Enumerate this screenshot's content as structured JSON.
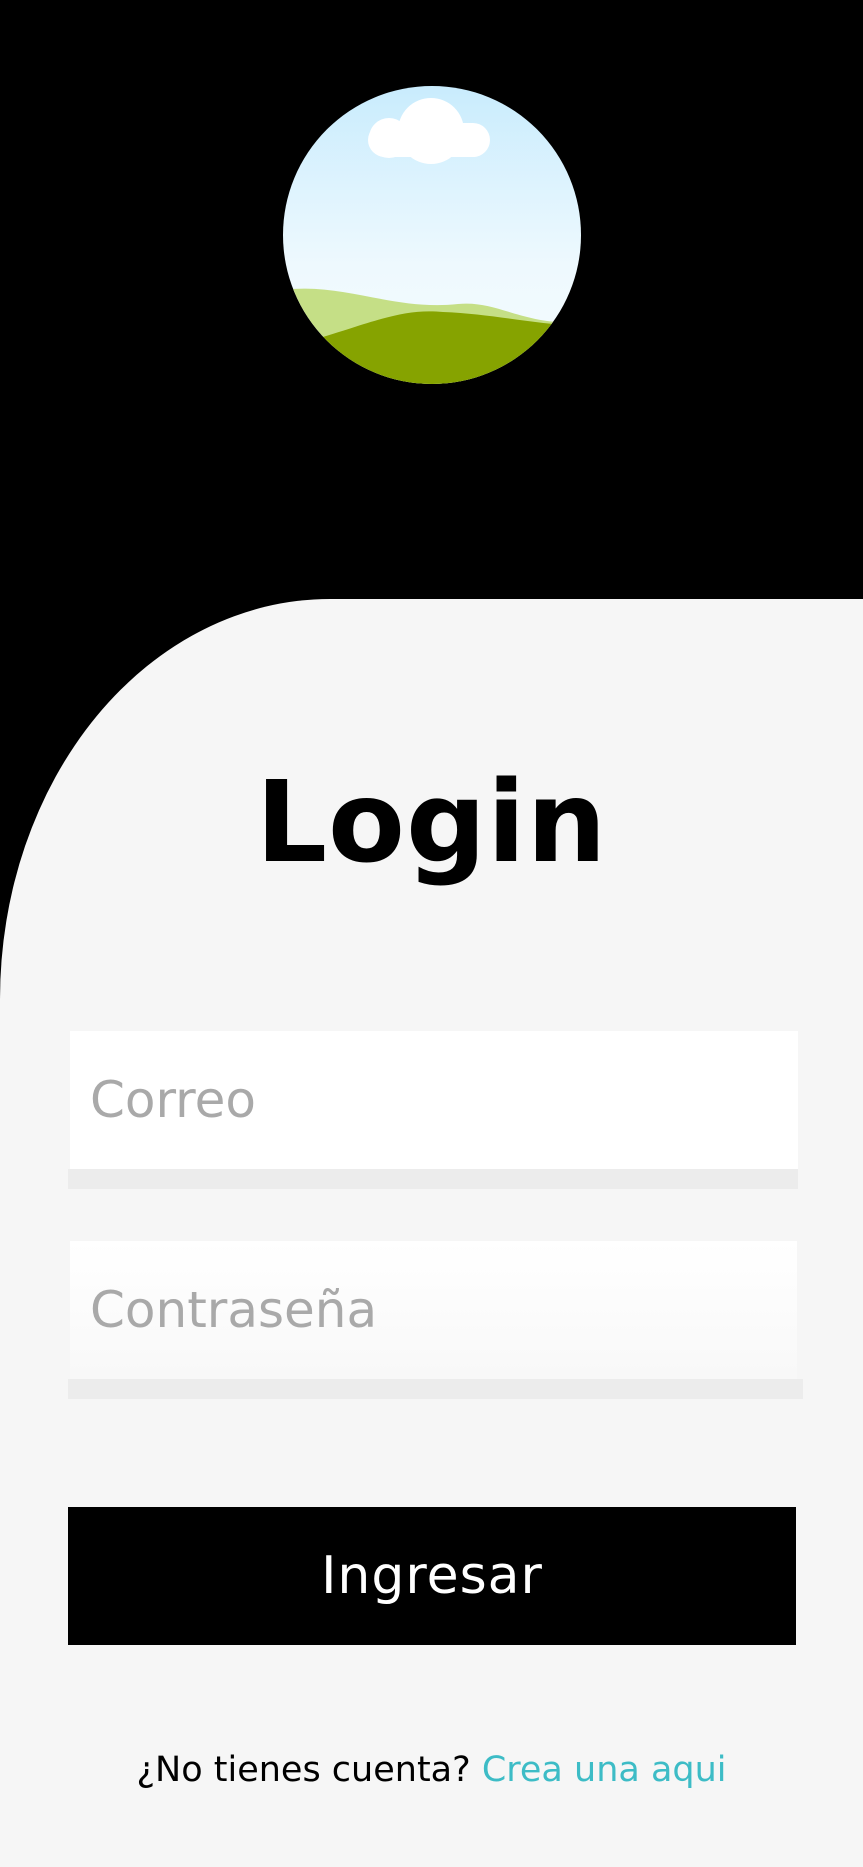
{
  "header": {
    "avatar_icon": "landscape-placeholder-icon"
  },
  "login": {
    "title": "Login",
    "email_placeholder": "Correo",
    "password_placeholder": "Contraseña",
    "submit_label": "Ingresar",
    "signup_prompt": "¿No tienes cuenta?",
    "signup_link": "Crea una aqui"
  },
  "colors": {
    "background_top": "#000000",
    "panel": "#f6f6f6",
    "input_background": "#ffffff",
    "placeholder": "#a9a9a9",
    "button": "#000000",
    "button_text": "#ffffff",
    "link": "#3dbcc6"
  }
}
